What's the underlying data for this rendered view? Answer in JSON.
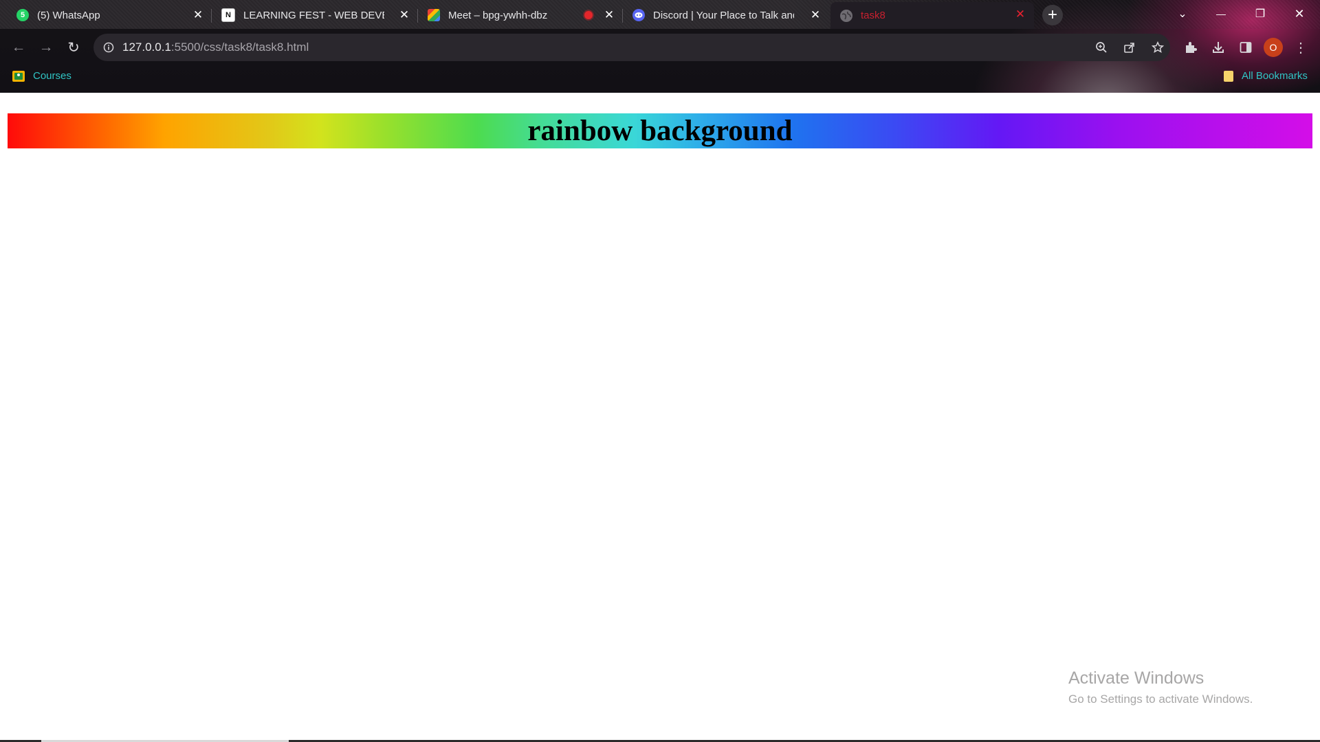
{
  "browser": {
    "tabs": [
      {
        "title": "(5) WhatsApp",
        "favicon": "whatsapp-icon",
        "favicon_color": "#25d366",
        "favicon_glyph": "5",
        "active": false
      },
      {
        "title": "LEARNING FEST - WEB DEVELOP",
        "favicon": "notion-icon",
        "favicon_color": "#ffffff",
        "favicon_glyph": "N",
        "active": false
      },
      {
        "title": "Meet – bpg-ywhh-dbz",
        "favicon": "google-meet-icon",
        "favicon_color": "#34a853",
        "favicon_glyph": "",
        "recording": true,
        "active": false
      },
      {
        "title": "Discord | Your Place to Talk and",
        "favicon": "discord-icon",
        "favicon_color": "#5865f2",
        "favicon_glyph": "",
        "active": false
      },
      {
        "title": "task8",
        "favicon": "globe-icon",
        "favicon_color": "#6f6c72",
        "favicon_glyph": "",
        "active": true
      }
    ],
    "new_tab_label": "+",
    "window_controls": {
      "tab_search": "⌄",
      "minimize": "—",
      "restore": "❐",
      "close": "✕"
    },
    "nav": {
      "back": "←",
      "forward": "→",
      "reload": "↻"
    },
    "url": {
      "host": "127.0.0.1",
      "rest": ":5500/css/task8/task8.html"
    },
    "profile_initial": "O",
    "bookmarks": [
      {
        "label": "Courses",
        "icon": "classroom-icon"
      }
    ],
    "all_bookmarks_label": "All Bookmarks",
    "accent_color": "#30c5c5",
    "active_tab_color": "#c8202f"
  },
  "page": {
    "heading": "rainbow background",
    "gradient_colors": [
      "#ff0a0a",
      "#ffa300",
      "#d2e31d",
      "#4ddc4f",
      "#3ad7d7",
      "#1e74ef",
      "#6418f5",
      "#d40ee8"
    ]
  },
  "os_overlay": {
    "title": "Activate Windows",
    "subtitle": "Go to Settings to activate Windows."
  }
}
